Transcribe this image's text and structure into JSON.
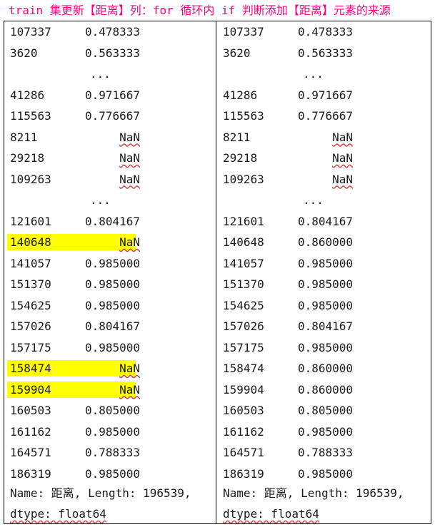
{
  "title": {
    "prefix": "train ",
    "cjk1": "集更新【距离】列：",
    "mid1": "for ",
    "cjk2": "循环内",
    "mid2": " if ",
    "cjk3": "判断添加【距离】元素的来源"
  },
  "left": {
    "rows": [
      {
        "idx": "107337",
        "val": "0.478333"
      },
      {
        "idx": "3620",
        "val": "0.563333"
      },
      {
        "dots": "..."
      },
      {
        "idx": "41286",
        "val": "0.971667"
      },
      {
        "idx": "115563",
        "val": "0.776667"
      },
      {
        "idx": "8211",
        "val": "NaN"
      },
      {
        "idx": "29218",
        "val": "NaN"
      },
      {
        "idx": "109263",
        "val": "NaN"
      },
      {
        "dots": "..."
      },
      {
        "idx": "121601",
        "val": "0.804167"
      },
      {
        "idx": "140648",
        "val": "NaN",
        "hl": true
      },
      {
        "idx": "141057",
        "val": "0.985000"
      },
      {
        "idx": "151370",
        "val": "0.985000"
      },
      {
        "idx": "154625",
        "val": "0.985000"
      },
      {
        "idx": "157026",
        "val": "0.804167"
      },
      {
        "idx": "157175",
        "val": "0.985000"
      },
      {
        "idx": "158474",
        "val": "NaN",
        "hl": true
      },
      {
        "idx": "159904",
        "val": "NaN",
        "hl": true
      },
      {
        "idx": "160503",
        "val": "0.805000"
      },
      {
        "idx": "161162",
        "val": "0.985000"
      },
      {
        "idx": "164571",
        "val": "0.788333"
      },
      {
        "idx": "186319",
        "val": "0.985000"
      }
    ],
    "footer1": "Name: 距离, Length: 196539,",
    "footer2": "dtype: float64"
  },
  "right": {
    "rows": [
      {
        "idx": "107337",
        "val": "0.478333"
      },
      {
        "idx": "3620",
        "val": "0.563333"
      },
      {
        "dots": "..."
      },
      {
        "idx": "41286",
        "val": "0.971667"
      },
      {
        "idx": "115563",
        "val": "0.776667"
      },
      {
        "idx": "8211",
        "val": "NaN"
      },
      {
        "idx": "29218",
        "val": "NaN"
      },
      {
        "idx": "109263",
        "val": "NaN"
      },
      {
        "dots": "..."
      },
      {
        "idx": "121601",
        "val": "0.804167"
      },
      {
        "idx": "140648",
        "val": "0.860000"
      },
      {
        "idx": "141057",
        "val": "0.985000"
      },
      {
        "idx": "151370",
        "val": "0.985000"
      },
      {
        "idx": "154625",
        "val": "0.985000"
      },
      {
        "idx": "157026",
        "val": "0.804167"
      },
      {
        "idx": "157175",
        "val": "0.985000"
      },
      {
        "idx": "158474",
        "val": "0.860000"
      },
      {
        "idx": "159904",
        "val": "0.860000"
      },
      {
        "idx": "160503",
        "val": "0.805000"
      },
      {
        "idx": "161162",
        "val": "0.985000"
      },
      {
        "idx": "164571",
        "val": "0.788333"
      },
      {
        "idx": "186319",
        "val": "0.985000"
      }
    ],
    "footer1": "Name: 距离, Length: 196539,",
    "footer2": "dtype: float64"
  },
  "colors": {
    "title": "#ff0080",
    "highlight": "#ffff00",
    "spellcheck": "#d05050"
  }
}
